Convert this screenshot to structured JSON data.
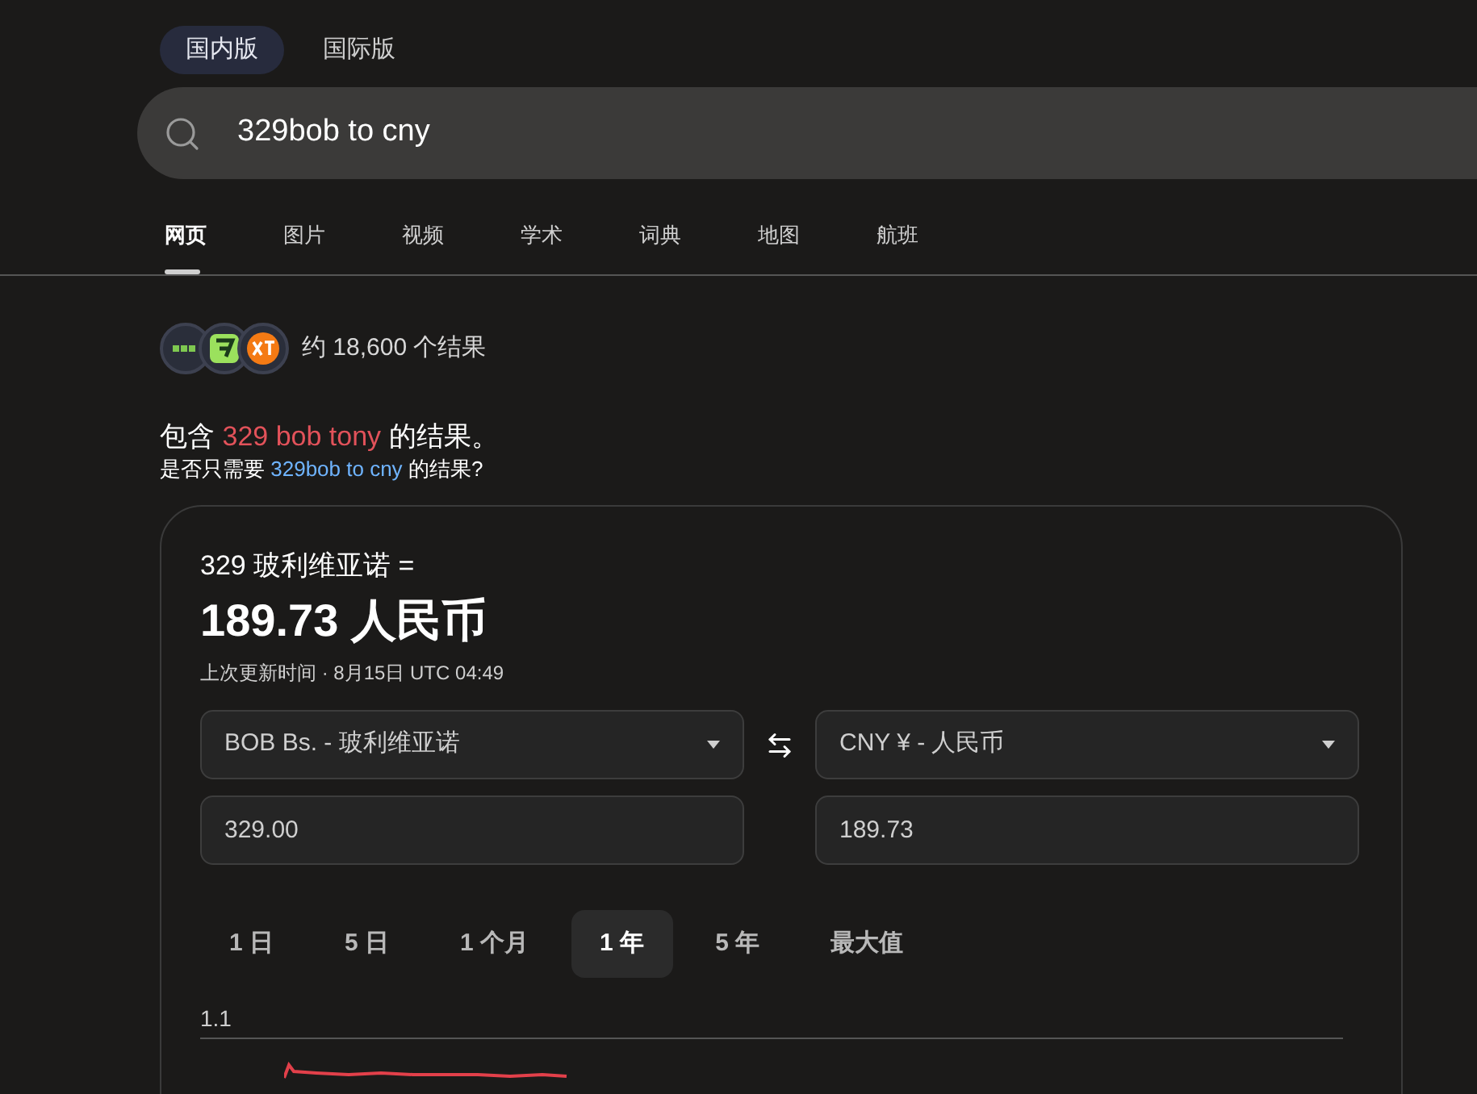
{
  "versions": [
    {
      "label": "国内版",
      "selected": true
    },
    {
      "label": "国际版",
      "selected": false
    }
  ],
  "search": {
    "value": "329bob to cny"
  },
  "nav_tabs": [
    {
      "label": "网页",
      "selected": true
    },
    {
      "label": "图片",
      "selected": false
    },
    {
      "label": "视频",
      "selected": false
    },
    {
      "label": "学术",
      "selected": false
    },
    {
      "label": "词典",
      "selected": false
    },
    {
      "label": "地图",
      "selected": false
    },
    {
      "label": "航班",
      "selected": false
    }
  ],
  "result_count": "约 18,600 个结果",
  "spell": {
    "prefix": "包含",
    "corrected": "329 bob tony",
    "suffix": "的结果。",
    "alt_prefix": "是否只需要",
    "alt_link": "329bob to cny",
    "alt_suffix": "的结果?"
  },
  "converter": {
    "from_line": "329 玻利维亚诺 =",
    "result": "189.73 人民币",
    "updated": "上次更新时间 · 8月15日 UTC 04:49",
    "from_currency": "BOB Bs. - 玻利维亚诺",
    "to_currency": "CNY ¥ - 人民币",
    "from_amount": "329.00",
    "to_amount": "189.73",
    "ranges": [
      {
        "label": "1 日",
        "selected": false
      },
      {
        "label": "5 日",
        "selected": false
      },
      {
        "label": "1 个月",
        "selected": false
      },
      {
        "label": "1 年",
        "selected": true
      },
      {
        "label": "5 年",
        "selected": false
      },
      {
        "label": "最大值",
        "selected": false
      }
    ],
    "chart_axis_label": "1.1"
  }
}
